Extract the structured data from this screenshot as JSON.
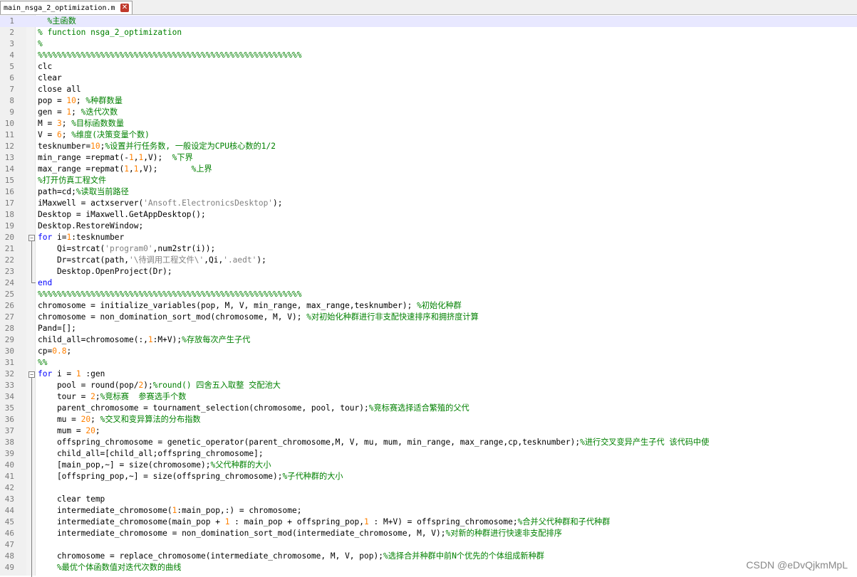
{
  "tab": {
    "title": "main_nsga_2_optimization.m",
    "close_icon": "close-icon"
  },
  "colors": {
    "comment": "#008000",
    "keyword": "#0000ff",
    "number": "#ff8000",
    "string": "#808080",
    "default": "#000000"
  },
  "watermark": "CSDN @eDvQjkmMpL",
  "lines": [
    [
      [
        "  ",
        "d"
      ],
      [
        "%主函数",
        "c"
      ]
    ],
    [
      [
        "% function nsga_2_optimization",
        "c"
      ]
    ],
    [
      [
        "%",
        "c"
      ]
    ],
    [
      [
        "%%%%%%%%%%%%%%%%%%%%%%%%%%%%%%%%%%%%%%%%%%%%%%%%%%%%%%%",
        "c"
      ]
    ],
    [
      [
        "clc",
        "d"
      ]
    ],
    [
      [
        "clear",
        "d"
      ]
    ],
    [
      [
        "close all",
        "d"
      ]
    ],
    [
      [
        "pop = ",
        "d"
      ],
      [
        "10",
        "n"
      ],
      [
        "; ",
        "d"
      ],
      [
        "%种群数量",
        "c"
      ]
    ],
    [
      [
        "gen = ",
        "d"
      ],
      [
        "1",
        "n"
      ],
      [
        "; ",
        "d"
      ],
      [
        "%迭代次数",
        "c"
      ]
    ],
    [
      [
        "M = ",
        "d"
      ],
      [
        "3",
        "n"
      ],
      [
        "; ",
        "d"
      ],
      [
        "%目标函数数量",
        "c"
      ]
    ],
    [
      [
        "V = ",
        "d"
      ],
      [
        "6",
        "n"
      ],
      [
        "; ",
        "d"
      ],
      [
        "%维度(决策变量个数)",
        "c"
      ]
    ],
    [
      [
        "tesknumber=",
        "d"
      ],
      [
        "10",
        "n"
      ],
      [
        ";",
        "d"
      ],
      [
        "%设置并行任务数, 一般设定为CPU核心数的1/2",
        "c"
      ]
    ],
    [
      [
        "min_range =repmat(-",
        "d"
      ],
      [
        "1",
        "n"
      ],
      [
        ",",
        "d"
      ],
      [
        "1",
        "n"
      ],
      [
        ",V);  ",
        "d"
      ],
      [
        "%下界",
        "c"
      ]
    ],
    [
      [
        "max_range =repmat(",
        "d"
      ],
      [
        "1",
        "n"
      ],
      [
        ",",
        "d"
      ],
      [
        "1",
        "n"
      ],
      [
        ",V);       ",
        "d"
      ],
      [
        "%上界",
        "c"
      ]
    ],
    [
      [
        "%打开仿真工程文件",
        "c"
      ]
    ],
    [
      [
        "path=cd;",
        "d"
      ],
      [
        "%读取当前路径",
        "c"
      ]
    ],
    [
      [
        "iMaxwell = actxserver(",
        "d"
      ],
      [
        "'Ansoft.ElectronicsDesktop'",
        "s"
      ],
      [
        ");",
        "d"
      ]
    ],
    [
      [
        "Desktop = iMaxwell.GetAppDesktop();",
        "d"
      ]
    ],
    [
      [
        "Desktop.RestoreWindow;",
        "d"
      ]
    ],
    [
      [
        "for",
        "k"
      ],
      [
        " i=",
        "d"
      ],
      [
        "1",
        "n"
      ],
      [
        ":tesknumber",
        "d"
      ]
    ],
    [
      [
        "    Qi=strcat(",
        "d"
      ],
      [
        "'program0'",
        "s"
      ],
      [
        ",num2str(i));",
        "d"
      ]
    ],
    [
      [
        "    Dr=strcat(path,",
        "d"
      ],
      [
        "'\\待调用工程文件\\'",
        "s"
      ],
      [
        ",Qi,",
        "d"
      ],
      [
        "'.aedt'",
        "s"
      ],
      [
        ");",
        "d"
      ]
    ],
    [
      [
        "    Desktop.OpenProject(Dr);",
        "d"
      ]
    ],
    [
      [
        "end",
        "k"
      ]
    ],
    [
      [
        "%%%%%%%%%%%%%%%%%%%%%%%%%%%%%%%%%%%%%%%%%%%%%%%%%%%%%%%",
        "c"
      ]
    ],
    [
      [
        "chromosome = initialize_variables(pop, M, V, min_range, max_range,tesknumber); ",
        "d"
      ],
      [
        "%初始化种群",
        "c"
      ]
    ],
    [
      [
        "chromosome = non_domination_sort_mod(chromosome, M, V); ",
        "d"
      ],
      [
        "%对初始化种群进行非支配快速排序和拥挤度计算",
        "c"
      ]
    ],
    [
      [
        "Pand=[];",
        "d"
      ]
    ],
    [
      [
        "child_all=chromosome(:,",
        "d"
      ],
      [
        "1",
        "n"
      ],
      [
        ":M+V);",
        "d"
      ],
      [
        "%存放每次产生子代",
        "c"
      ]
    ],
    [
      [
        "cp=",
        "d"
      ],
      [
        "0.8",
        "n"
      ],
      [
        ";",
        "d"
      ]
    ],
    [
      [
        "%%",
        "c"
      ]
    ],
    [
      [
        "for",
        "k"
      ],
      [
        " i = ",
        "d"
      ],
      [
        "1",
        "n"
      ],
      [
        " :gen",
        "d"
      ]
    ],
    [
      [
        "    pool = round(pop/",
        "d"
      ],
      [
        "2",
        "n"
      ],
      [
        ");",
        "d"
      ],
      [
        "%round() 四舍五入取整 交配池大",
        "c"
      ]
    ],
    [
      [
        "    tour = ",
        "d"
      ],
      [
        "2",
        "n"
      ],
      [
        ";",
        "d"
      ],
      [
        "%竞标赛  参赛选手个数",
        "c"
      ]
    ],
    [
      [
        "    parent_chromosome = tournament_selection(chromosome, pool, tour);",
        "d"
      ],
      [
        "%竞标赛选择适合繁殖的父代",
        "c"
      ]
    ],
    [
      [
        "    mu = ",
        "d"
      ],
      [
        "20",
        "n"
      ],
      [
        "; ",
        "d"
      ],
      [
        "%交叉和变异算法的分布指数",
        "c"
      ]
    ],
    [
      [
        "    mum = ",
        "d"
      ],
      [
        "20",
        "n"
      ],
      [
        ";",
        "d"
      ]
    ],
    [
      [
        "    offspring_chromosome = genetic_operator(parent_chromosome,M, V, mu, mum, min_range, max_range,cp,tesknumber);",
        "d"
      ],
      [
        "%进行交叉变异产生子代 该代码中使",
        "c"
      ]
    ],
    [
      [
        "    child_all=[child_all;offspring_chromosome];",
        "d"
      ]
    ],
    [
      [
        "    [main_pop,~] = size(chromosome);",
        "d"
      ],
      [
        "%父代种群的大小",
        "c"
      ]
    ],
    [
      [
        "    [offspring_pop,~] = size(offspring_chromosome);",
        "d"
      ],
      [
        "%子代种群的大小",
        "c"
      ]
    ],
    [
      [
        "",
        "d"
      ]
    ],
    [
      [
        "    clear temp",
        "d"
      ]
    ],
    [
      [
        "    intermediate_chromosome(",
        "d"
      ],
      [
        "1",
        "n"
      ],
      [
        ":main_pop,:) = chromosome;",
        "d"
      ]
    ],
    [
      [
        "    intermediate_chromosome(main_pop + ",
        "d"
      ],
      [
        "1",
        "n"
      ],
      [
        " : main_pop + offspring_pop,",
        "d"
      ],
      [
        "1",
        "n"
      ],
      [
        " : M+V) = offspring_chromosome;",
        "d"
      ],
      [
        "%合并父代种群和子代种群",
        "c"
      ]
    ],
    [
      [
        "    intermediate_chromosome = non_domination_sort_mod(intermediate_chromosome, M, V);",
        "d"
      ],
      [
        "%对新的种群进行快速非支配排序",
        "c"
      ]
    ],
    [
      [
        "",
        "d"
      ]
    ],
    [
      [
        "    chromosome = replace_chromosome(intermediate_chromosome, M, V, pop);",
        "d"
      ],
      [
        "%选择合并种群中前N个优先的个体组成新种群",
        "c"
      ]
    ],
    [
      [
        "    %最优个体函数值对迭代次数的曲线",
        "c"
      ]
    ]
  ]
}
